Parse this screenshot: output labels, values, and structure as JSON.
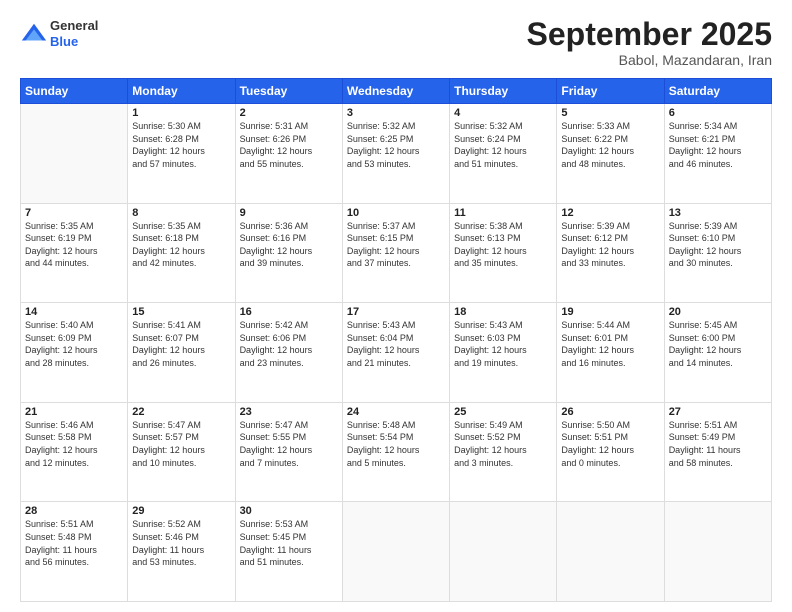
{
  "header": {
    "logo": {
      "general": "General",
      "blue": "Blue"
    },
    "title": "September 2025",
    "subtitle": "Babol, Mazandaran, Iran"
  },
  "days_of_week": [
    "Sunday",
    "Monday",
    "Tuesday",
    "Wednesday",
    "Thursday",
    "Friday",
    "Saturday"
  ],
  "weeks": [
    [
      {
        "day": "",
        "info": ""
      },
      {
        "day": "1",
        "info": "Sunrise: 5:30 AM\nSunset: 6:28 PM\nDaylight: 12 hours\nand 57 minutes."
      },
      {
        "day": "2",
        "info": "Sunrise: 5:31 AM\nSunset: 6:26 PM\nDaylight: 12 hours\nand 55 minutes."
      },
      {
        "day": "3",
        "info": "Sunrise: 5:32 AM\nSunset: 6:25 PM\nDaylight: 12 hours\nand 53 minutes."
      },
      {
        "day": "4",
        "info": "Sunrise: 5:32 AM\nSunset: 6:24 PM\nDaylight: 12 hours\nand 51 minutes."
      },
      {
        "day": "5",
        "info": "Sunrise: 5:33 AM\nSunset: 6:22 PM\nDaylight: 12 hours\nand 48 minutes."
      },
      {
        "day": "6",
        "info": "Sunrise: 5:34 AM\nSunset: 6:21 PM\nDaylight: 12 hours\nand 46 minutes."
      }
    ],
    [
      {
        "day": "7",
        "info": "Sunrise: 5:35 AM\nSunset: 6:19 PM\nDaylight: 12 hours\nand 44 minutes."
      },
      {
        "day": "8",
        "info": "Sunrise: 5:35 AM\nSunset: 6:18 PM\nDaylight: 12 hours\nand 42 minutes."
      },
      {
        "day": "9",
        "info": "Sunrise: 5:36 AM\nSunset: 6:16 PM\nDaylight: 12 hours\nand 39 minutes."
      },
      {
        "day": "10",
        "info": "Sunrise: 5:37 AM\nSunset: 6:15 PM\nDaylight: 12 hours\nand 37 minutes."
      },
      {
        "day": "11",
        "info": "Sunrise: 5:38 AM\nSunset: 6:13 PM\nDaylight: 12 hours\nand 35 minutes."
      },
      {
        "day": "12",
        "info": "Sunrise: 5:39 AM\nSunset: 6:12 PM\nDaylight: 12 hours\nand 33 minutes."
      },
      {
        "day": "13",
        "info": "Sunrise: 5:39 AM\nSunset: 6:10 PM\nDaylight: 12 hours\nand 30 minutes."
      }
    ],
    [
      {
        "day": "14",
        "info": "Sunrise: 5:40 AM\nSunset: 6:09 PM\nDaylight: 12 hours\nand 28 minutes."
      },
      {
        "day": "15",
        "info": "Sunrise: 5:41 AM\nSunset: 6:07 PM\nDaylight: 12 hours\nand 26 minutes."
      },
      {
        "day": "16",
        "info": "Sunrise: 5:42 AM\nSunset: 6:06 PM\nDaylight: 12 hours\nand 23 minutes."
      },
      {
        "day": "17",
        "info": "Sunrise: 5:43 AM\nSunset: 6:04 PM\nDaylight: 12 hours\nand 21 minutes."
      },
      {
        "day": "18",
        "info": "Sunrise: 5:43 AM\nSunset: 6:03 PM\nDaylight: 12 hours\nand 19 minutes."
      },
      {
        "day": "19",
        "info": "Sunrise: 5:44 AM\nSunset: 6:01 PM\nDaylight: 12 hours\nand 16 minutes."
      },
      {
        "day": "20",
        "info": "Sunrise: 5:45 AM\nSunset: 6:00 PM\nDaylight: 12 hours\nand 14 minutes."
      }
    ],
    [
      {
        "day": "21",
        "info": "Sunrise: 5:46 AM\nSunset: 5:58 PM\nDaylight: 12 hours\nand 12 minutes."
      },
      {
        "day": "22",
        "info": "Sunrise: 5:47 AM\nSunset: 5:57 PM\nDaylight: 12 hours\nand 10 minutes."
      },
      {
        "day": "23",
        "info": "Sunrise: 5:47 AM\nSunset: 5:55 PM\nDaylight: 12 hours\nand 7 minutes."
      },
      {
        "day": "24",
        "info": "Sunrise: 5:48 AM\nSunset: 5:54 PM\nDaylight: 12 hours\nand 5 minutes."
      },
      {
        "day": "25",
        "info": "Sunrise: 5:49 AM\nSunset: 5:52 PM\nDaylight: 12 hours\nand 3 minutes."
      },
      {
        "day": "26",
        "info": "Sunrise: 5:50 AM\nSunset: 5:51 PM\nDaylight: 12 hours\nand 0 minutes."
      },
      {
        "day": "27",
        "info": "Sunrise: 5:51 AM\nSunset: 5:49 PM\nDaylight: 11 hours\nand 58 minutes."
      }
    ],
    [
      {
        "day": "28",
        "info": "Sunrise: 5:51 AM\nSunset: 5:48 PM\nDaylight: 11 hours\nand 56 minutes."
      },
      {
        "day": "29",
        "info": "Sunrise: 5:52 AM\nSunset: 5:46 PM\nDaylight: 11 hours\nand 53 minutes."
      },
      {
        "day": "30",
        "info": "Sunrise: 5:53 AM\nSunset: 5:45 PM\nDaylight: 11 hours\nand 51 minutes."
      },
      {
        "day": "",
        "info": ""
      },
      {
        "day": "",
        "info": ""
      },
      {
        "day": "",
        "info": ""
      },
      {
        "day": "",
        "info": ""
      }
    ]
  ]
}
